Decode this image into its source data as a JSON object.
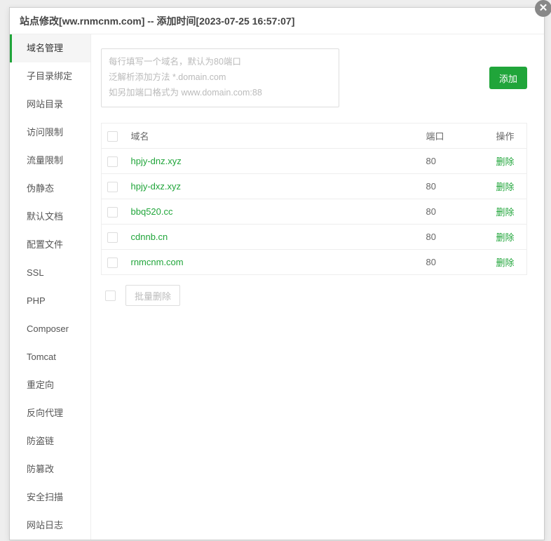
{
  "title": "站点修改[ww.rnmcnm.com] -- 添加时间[2023-07-25 16:57:07]",
  "sidebar": {
    "items": [
      "域名管理",
      "子目录绑定",
      "网站目录",
      "访问限制",
      "流量限制",
      "伪静态",
      "默认文档",
      "配置文件",
      "SSL",
      "PHP",
      "Composer",
      "Tomcat",
      "重定向",
      "反向代理",
      "防盗链",
      "防篡改",
      "安全扫描",
      "网站日志"
    ],
    "active_index": 0
  },
  "input": {
    "placeholder": "每行填写一个域名，默认为80端口\n泛解析添加方法 *.domain.com\n如另加端口格式为 www.domain.com:88"
  },
  "buttons": {
    "add": "添加",
    "batch_delete": "批量删除"
  },
  "table": {
    "headers": {
      "domain": "域名",
      "port": "端口",
      "action": "操作"
    },
    "delete_label": "删除",
    "rows": [
      {
        "domain": "hpjy-dnz.xyz",
        "port": "80"
      },
      {
        "domain": "hpjy-dxz.xyz",
        "port": "80"
      },
      {
        "domain": "bbq520.cc",
        "port": "80"
      },
      {
        "domain": "cdnnb.cn",
        "port": "80"
      },
      {
        "domain": "rnmcnm.com",
        "port": "80"
      }
    ]
  }
}
